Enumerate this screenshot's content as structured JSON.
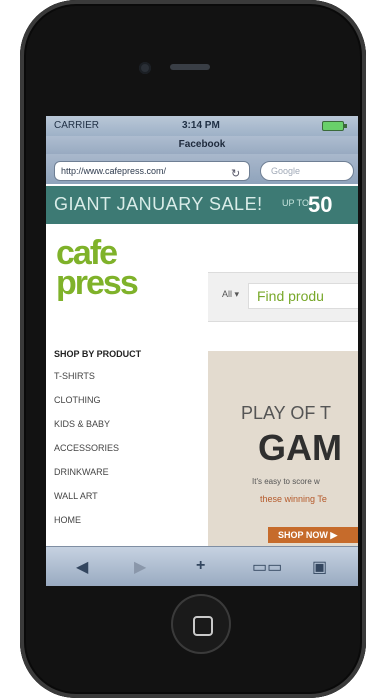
{
  "status": {
    "carrier": "CARRIER",
    "time": "3:14 PM"
  },
  "browser": {
    "page_title": "Facebook",
    "url": "http://www.cafepress.com/",
    "search_placeholder": "Google"
  },
  "banner": {
    "sale": "GIANT JANUARY SALE!",
    "upto": "UP TO",
    "percent": "50"
  },
  "logo": {
    "cafe": "cafe",
    "press": "press"
  },
  "search": {
    "all_label": "All ▾",
    "find_placeholder": "Find produ"
  },
  "nav": {
    "heading": "SHOP BY PRODUCT",
    "items": [
      "T-SHIRTS",
      "CLOTHING",
      "KIDS & BABY",
      "ACCESSORIES",
      "DRINKWARE",
      "WALL ART",
      "HOME"
    ]
  },
  "promo": {
    "line1": "PLAY OF T",
    "line2": "GAM",
    "line3": "It's easy to score w",
    "line4": "these winning Te",
    "shop_btn": "SHOP NOW ▶"
  },
  "toolbar": {
    "back": "◀",
    "forward": "▶",
    "add": "+",
    "bookmarks": "▭▭",
    "pages": "▣"
  }
}
